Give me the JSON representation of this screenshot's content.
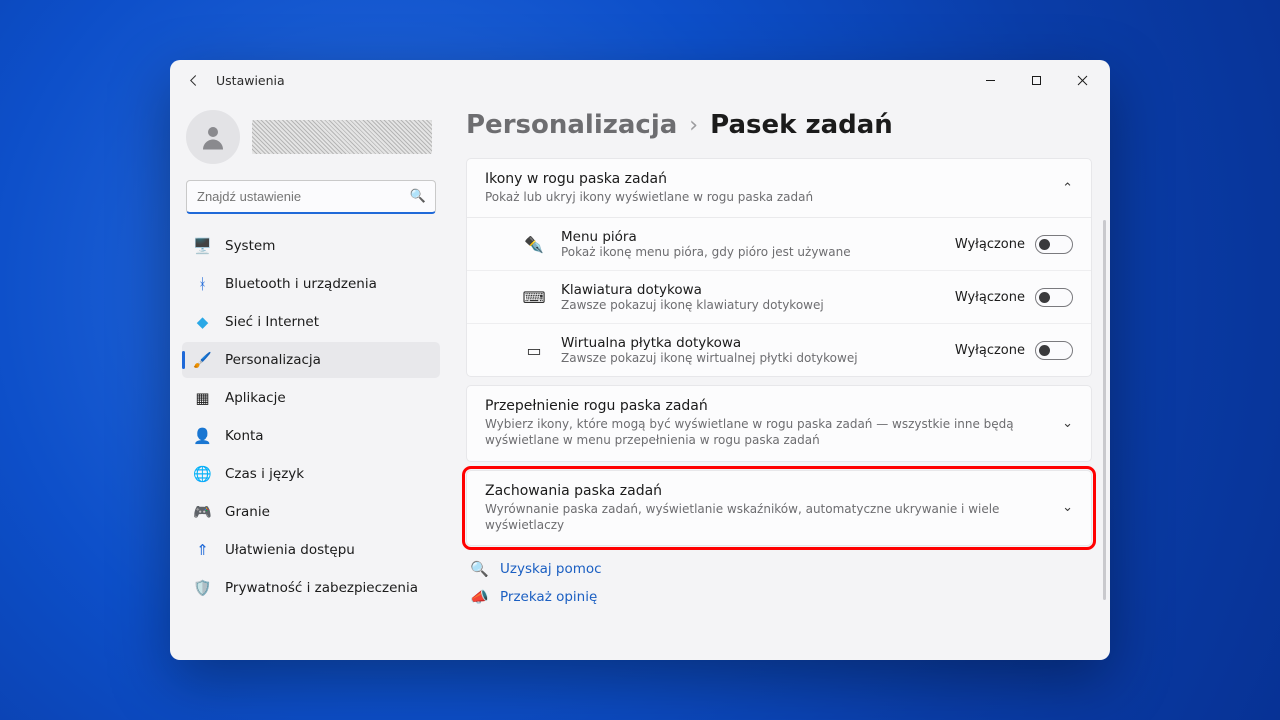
{
  "window": {
    "app_title": "Ustawienia"
  },
  "search": {
    "placeholder": "Znajdź ustawienie"
  },
  "nav": {
    "items": [
      {
        "id": "system",
        "label": "System",
        "icon": "🖥️"
      },
      {
        "id": "bluetooth",
        "label": "Bluetooth i urządzenia",
        "icon": "ᚼ",
        "icon_color": "#1f69d8"
      },
      {
        "id": "network",
        "label": "Sieć i Internet",
        "icon": "◆",
        "icon_color": "#2aa8e6"
      },
      {
        "id": "personalize",
        "label": "Personalizacja",
        "icon": "🖌️",
        "active": true
      },
      {
        "id": "apps",
        "label": "Aplikacje",
        "icon": "▦"
      },
      {
        "id": "accounts",
        "label": "Konta",
        "icon": "👤",
        "icon_color": "#2fa66b"
      },
      {
        "id": "time",
        "label": "Czas i język",
        "icon": "🌐"
      },
      {
        "id": "gaming",
        "label": "Granie",
        "icon": "🎮"
      },
      {
        "id": "accessibility",
        "label": "Ułatwienia dostępu",
        "icon": "⇑",
        "icon_color": "#1f69d8"
      },
      {
        "id": "privacy",
        "label": "Prywatność i zabezpieczenia",
        "icon": "🛡️"
      }
    ]
  },
  "breadcrumb": {
    "parent": "Personalizacja",
    "sep": "›",
    "current": "Pasek zadań"
  },
  "sections": {
    "corner_icons": {
      "title": "Ikony w rogu paska zadań",
      "desc": "Pokaż lub ukryj ikony wyświetlane w rogu paska zadań",
      "expanded": true,
      "items": [
        {
          "id": "pen",
          "icon": "✒️",
          "title": "Menu pióra",
          "desc": "Pokaż ikonę menu pióra, gdy pióro jest używane",
          "state": "Wyłączone"
        },
        {
          "id": "touchkb",
          "icon": "⌨",
          "title": "Klawiatura dotykowa",
          "desc": "Zawsze pokazuj ikonę klawiatury dotykowej",
          "state": "Wyłączone"
        },
        {
          "id": "touchpad",
          "icon": "▭",
          "title": "Wirtualna płytka dotykowa",
          "desc": "Zawsze pokazuj ikonę wirtualnej płytki dotykowej",
          "state": "Wyłączone"
        }
      ]
    },
    "overflow": {
      "title": "Przepełnienie rogu paska zadań",
      "desc": "Wybierz ikony, które mogą być wyświetlane w rogu paska zadań — wszystkie inne będą wyświetlane w menu przepełnienia w rogu paska zadań"
    },
    "behaviors": {
      "title": "Zachowania paska zadań",
      "desc": "Wyrównanie paska zadań, wyświetlanie wskaźników, automatyczne ukrywanie i wiele wyświetlaczy",
      "highlighted": true
    }
  },
  "footer": {
    "help": {
      "label": "Uzyskaj pomoc",
      "icon": "🔍"
    },
    "feedback": {
      "label": "Przekaż opinię",
      "icon": "📣"
    }
  },
  "toggle_off_label": "Wyłączone"
}
